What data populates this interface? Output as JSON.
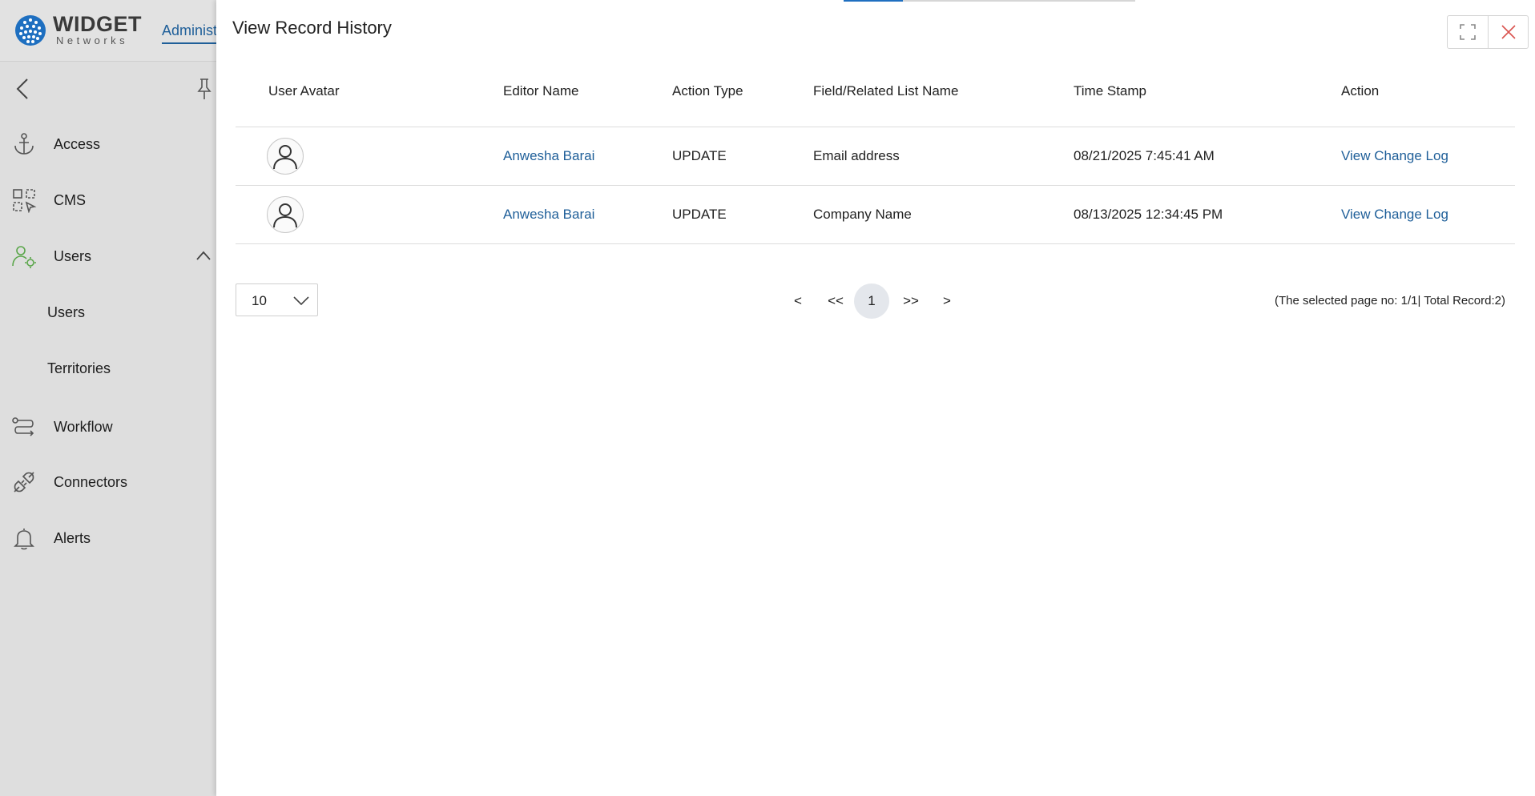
{
  "brand": {
    "name": "WIDGET",
    "sub": "Networks",
    "admin_tab": "Administration"
  },
  "sidebar": {
    "items": [
      {
        "label": "Access",
        "icon": "anchor-icon"
      },
      {
        "label": "CMS",
        "icon": "cms-icon"
      },
      {
        "label": "Users",
        "icon": "users-gear-icon",
        "expanded": true,
        "children": [
          {
            "label": "Users"
          },
          {
            "label": "Territories"
          }
        ]
      },
      {
        "label": "Workflow",
        "icon": "workflow-icon"
      },
      {
        "label": "Connectors",
        "icon": "plug-icon"
      },
      {
        "label": "Alerts",
        "icon": "bell-icon"
      }
    ]
  },
  "panel": {
    "title": "View Record History",
    "columns": [
      "User Avatar",
      "Editor Name",
      "Action Type",
      "Field/Related List Name",
      "Time Stamp",
      "Action"
    ],
    "rows": [
      {
        "editor": "Anwesha Barai",
        "action_type": "UPDATE",
        "field": "Email address",
        "timestamp": "08/21/2025 7:45:41 AM",
        "action": "View Change Log"
      },
      {
        "editor": "Anwesha Barai",
        "action_type": "UPDATE",
        "field": "Company Name",
        "timestamp": "08/13/2025 12:34:45 PM",
        "action": "View Change Log"
      }
    ],
    "page_size": "10",
    "pager": {
      "prev": "<",
      "first": "<<",
      "current": "1",
      "last": ">>",
      "next": ">"
    },
    "page_info": "(The selected page no: 1/1| Total Record:2)"
  },
  "colors": {
    "link": "#1f5f99",
    "accent": "#1f6fc0",
    "close": "#d9534f"
  }
}
